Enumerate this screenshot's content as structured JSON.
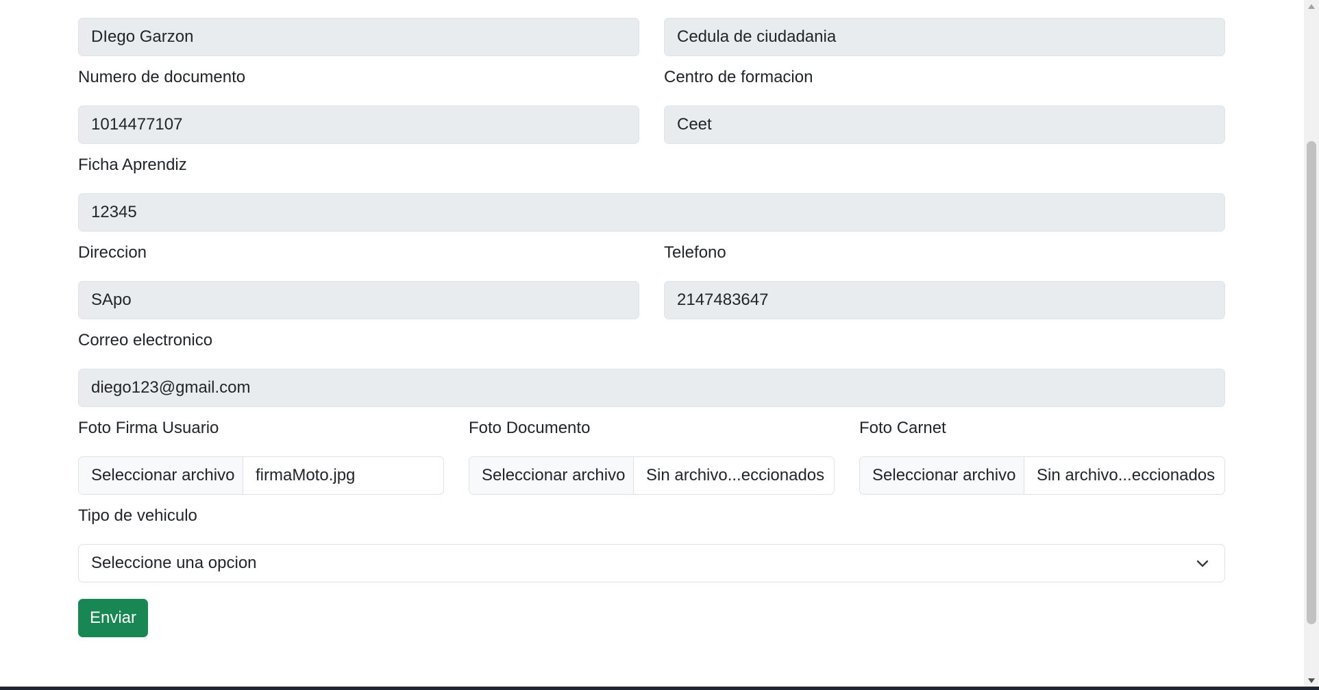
{
  "form": {
    "nombre_value": "DIego Garzon",
    "tipo_documento_value": "Cedula de ciudadania",
    "numero_documento_label": "Numero de documento",
    "numero_documento_value": "1014477107",
    "centro_formacion_label": "Centro de formacion",
    "centro_formacion_value": "Ceet",
    "ficha_label": "Ficha Aprendiz",
    "ficha_value": "12345",
    "direccion_label": "Direccion",
    "direccion_value": "SApo",
    "telefono_label": "Telefono",
    "telefono_value": "2147483647",
    "correo_label": "Correo electronico",
    "correo_value": "diego123@gmail.com",
    "foto_firma_label": "Foto Firma Usuario",
    "foto_firma_button": "Seleccionar archivo",
    "foto_firma_filename": "firmaMoto.jpg",
    "foto_documento_label": "Foto Documento",
    "foto_documento_button": "Seleccionar archivo",
    "foto_documento_filename": "Sin archivo...eccionados",
    "foto_carnet_label": "Foto Carnet",
    "foto_carnet_button": "Seleccionar archivo",
    "foto_carnet_filename": "Sin archivo...eccionados",
    "tipo_vehiculo_label": "Tipo de vehiculo",
    "tipo_vehiculo_selected": "Seleccione una opcion",
    "submit_label": "Enviar"
  },
  "colors": {
    "readonly_bg": "#e9ecef",
    "submit_bg": "#198754",
    "border": "#dee2e6"
  },
  "icons": {
    "select_chevron": "chevron-down-icon"
  }
}
